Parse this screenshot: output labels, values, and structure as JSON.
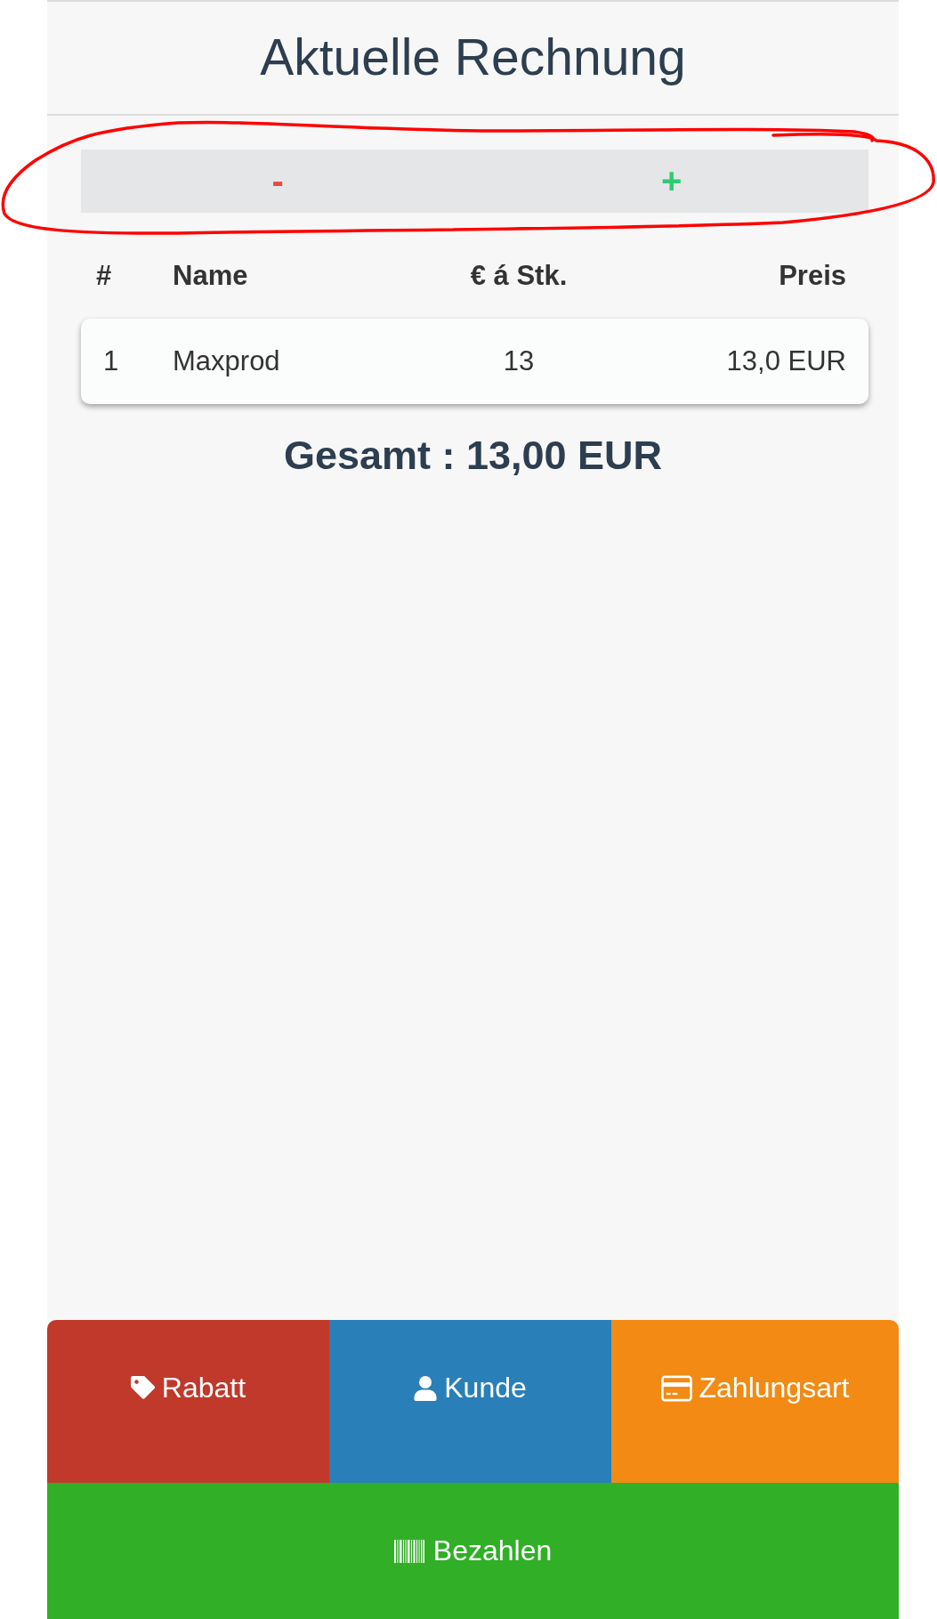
{
  "page": {
    "title": "Aktuelle Rechnung"
  },
  "quantity_bar": {
    "buttons": [
      {
        "kind": "minus",
        "label": "-"
      },
      {
        "kind": "plus",
        "label": "+"
      }
    ]
  },
  "table": {
    "columns": [
      "#",
      "Name",
      "€ á Stk.",
      "Preis"
    ],
    "rows": [
      [
        "1",
        "Maxprod",
        "13",
        "13,0 EUR"
      ]
    ]
  },
  "total": "Gesamt : 13,00 EUR",
  "options": [
    {
      "kind": "tag",
      "label": "Rabatt",
      "color": "#c0392b"
    },
    {
      "kind": "user",
      "label": "Kunde",
      "color": "#2980b9"
    },
    {
      "kind": "card",
      "label": "Zahlungsart",
      "color": "#f28a14"
    }
  ],
  "pay_button": {
    "label": "Bezahlen"
  }
}
